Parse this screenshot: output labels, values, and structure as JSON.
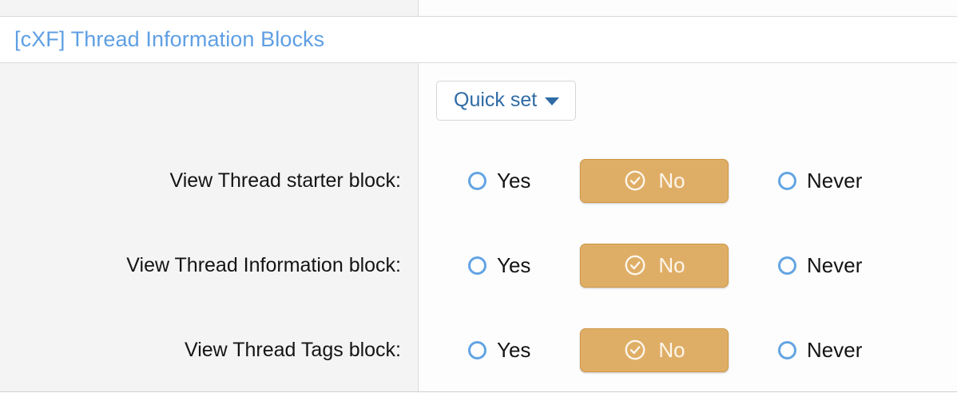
{
  "header": {
    "title": "[cXF] Thread Information Blocks",
    "title_color": "#5f9fe3"
  },
  "toolbar": {
    "quick_set_label": "Quick set",
    "caret_icon": "chevron-down-icon"
  },
  "colors": {
    "selected_background": "#dfae66",
    "selected_border": "#cf9745",
    "radio_ring": "#63a4e3",
    "link_blue": "#2f6ba5",
    "label_column_background": "#f4f4f4"
  },
  "options": {
    "yes": "Yes",
    "no": "No",
    "never": "Never",
    "selected_icon": "check-circle-icon"
  },
  "rows": [
    {
      "label": "View Thread starter block:",
      "yes": "Yes",
      "no": "No",
      "never": "Never",
      "selected": "no"
    },
    {
      "label": "View Thread Information block:",
      "yes": "Yes",
      "no": "No",
      "never": "Never",
      "selected": "no"
    },
    {
      "label": "View Thread Tags block:",
      "yes": "Yes",
      "no": "No",
      "never": "Never",
      "selected": "no"
    }
  ]
}
